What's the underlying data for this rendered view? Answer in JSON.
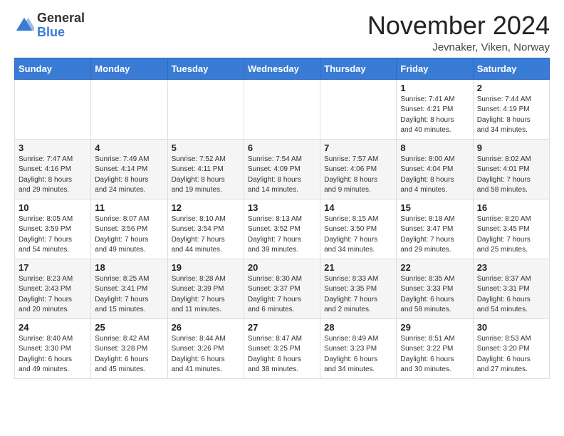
{
  "logo": {
    "general": "General",
    "blue": "Blue"
  },
  "title": "November 2024",
  "location": "Jevnaker, Viken, Norway",
  "weekdays": [
    "Sunday",
    "Monday",
    "Tuesday",
    "Wednesday",
    "Thursday",
    "Friday",
    "Saturday"
  ],
  "weeks": [
    [
      {
        "day": "",
        "info": ""
      },
      {
        "day": "",
        "info": ""
      },
      {
        "day": "",
        "info": ""
      },
      {
        "day": "",
        "info": ""
      },
      {
        "day": "",
        "info": ""
      },
      {
        "day": "1",
        "info": "Sunrise: 7:41 AM\nSunset: 4:21 PM\nDaylight: 8 hours\nand 40 minutes."
      },
      {
        "day": "2",
        "info": "Sunrise: 7:44 AM\nSunset: 4:19 PM\nDaylight: 8 hours\nand 34 minutes."
      }
    ],
    [
      {
        "day": "3",
        "info": "Sunrise: 7:47 AM\nSunset: 4:16 PM\nDaylight: 8 hours\nand 29 minutes."
      },
      {
        "day": "4",
        "info": "Sunrise: 7:49 AM\nSunset: 4:14 PM\nDaylight: 8 hours\nand 24 minutes."
      },
      {
        "day": "5",
        "info": "Sunrise: 7:52 AM\nSunset: 4:11 PM\nDaylight: 8 hours\nand 19 minutes."
      },
      {
        "day": "6",
        "info": "Sunrise: 7:54 AM\nSunset: 4:09 PM\nDaylight: 8 hours\nand 14 minutes."
      },
      {
        "day": "7",
        "info": "Sunrise: 7:57 AM\nSunset: 4:06 PM\nDaylight: 8 hours\nand 9 minutes."
      },
      {
        "day": "8",
        "info": "Sunrise: 8:00 AM\nSunset: 4:04 PM\nDaylight: 8 hours\nand 4 minutes."
      },
      {
        "day": "9",
        "info": "Sunrise: 8:02 AM\nSunset: 4:01 PM\nDaylight: 7 hours\nand 58 minutes."
      }
    ],
    [
      {
        "day": "10",
        "info": "Sunrise: 8:05 AM\nSunset: 3:59 PM\nDaylight: 7 hours\nand 54 minutes."
      },
      {
        "day": "11",
        "info": "Sunrise: 8:07 AM\nSunset: 3:56 PM\nDaylight: 7 hours\nand 49 minutes."
      },
      {
        "day": "12",
        "info": "Sunrise: 8:10 AM\nSunset: 3:54 PM\nDaylight: 7 hours\nand 44 minutes."
      },
      {
        "day": "13",
        "info": "Sunrise: 8:13 AM\nSunset: 3:52 PM\nDaylight: 7 hours\nand 39 minutes."
      },
      {
        "day": "14",
        "info": "Sunrise: 8:15 AM\nSunset: 3:50 PM\nDaylight: 7 hours\nand 34 minutes."
      },
      {
        "day": "15",
        "info": "Sunrise: 8:18 AM\nSunset: 3:47 PM\nDaylight: 7 hours\nand 29 minutes."
      },
      {
        "day": "16",
        "info": "Sunrise: 8:20 AM\nSunset: 3:45 PM\nDaylight: 7 hours\nand 25 minutes."
      }
    ],
    [
      {
        "day": "17",
        "info": "Sunrise: 8:23 AM\nSunset: 3:43 PM\nDaylight: 7 hours\nand 20 minutes."
      },
      {
        "day": "18",
        "info": "Sunrise: 8:25 AM\nSunset: 3:41 PM\nDaylight: 7 hours\nand 15 minutes."
      },
      {
        "day": "19",
        "info": "Sunrise: 8:28 AM\nSunset: 3:39 PM\nDaylight: 7 hours\nand 11 minutes."
      },
      {
        "day": "20",
        "info": "Sunrise: 8:30 AM\nSunset: 3:37 PM\nDaylight: 7 hours\nand 6 minutes."
      },
      {
        "day": "21",
        "info": "Sunrise: 8:33 AM\nSunset: 3:35 PM\nDaylight: 7 hours\nand 2 minutes."
      },
      {
        "day": "22",
        "info": "Sunrise: 8:35 AM\nSunset: 3:33 PM\nDaylight: 6 hours\nand 58 minutes."
      },
      {
        "day": "23",
        "info": "Sunrise: 8:37 AM\nSunset: 3:31 PM\nDaylight: 6 hours\nand 54 minutes."
      }
    ],
    [
      {
        "day": "24",
        "info": "Sunrise: 8:40 AM\nSunset: 3:30 PM\nDaylight: 6 hours\nand 49 minutes."
      },
      {
        "day": "25",
        "info": "Sunrise: 8:42 AM\nSunset: 3:28 PM\nDaylight: 6 hours\nand 45 minutes."
      },
      {
        "day": "26",
        "info": "Sunrise: 8:44 AM\nSunset: 3:26 PM\nDaylight: 6 hours\nand 41 minutes."
      },
      {
        "day": "27",
        "info": "Sunrise: 8:47 AM\nSunset: 3:25 PM\nDaylight: 6 hours\nand 38 minutes."
      },
      {
        "day": "28",
        "info": "Sunrise: 8:49 AM\nSunset: 3:23 PM\nDaylight: 6 hours\nand 34 minutes."
      },
      {
        "day": "29",
        "info": "Sunrise: 8:51 AM\nSunset: 3:22 PM\nDaylight: 6 hours\nand 30 minutes."
      },
      {
        "day": "30",
        "info": "Sunrise: 8:53 AM\nSunset: 3:20 PM\nDaylight: 6 hours\nand 27 minutes."
      }
    ]
  ]
}
